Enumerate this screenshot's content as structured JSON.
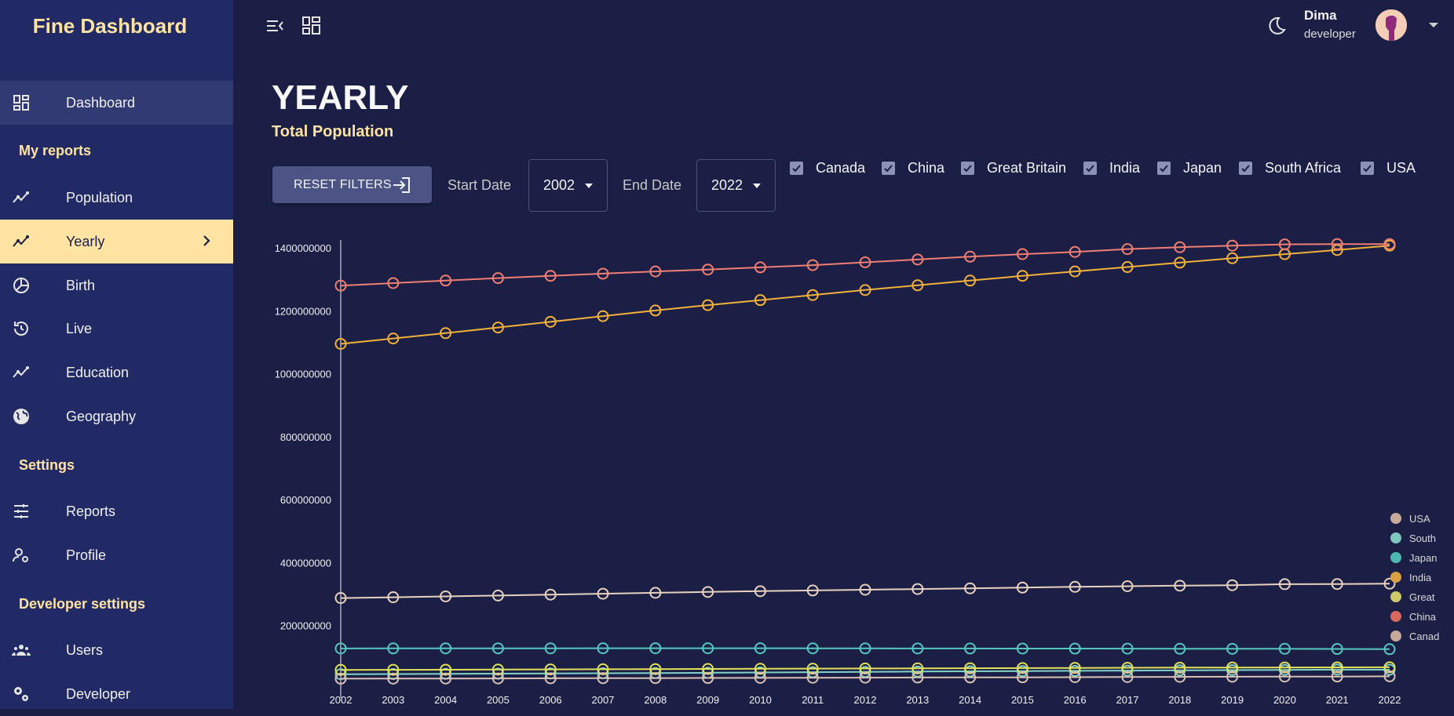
{
  "app": {
    "title": "Fine Dashboard"
  },
  "sidebar": {
    "items": [
      {
        "label": "Dashboard",
        "icon": "dashboard-icon"
      },
      {
        "label": "Population",
        "icon": "trending-icon"
      },
      {
        "label": "Yearly",
        "icon": "trending-icon"
      },
      {
        "label": "Birth",
        "icon": "pie-chart-icon"
      },
      {
        "label": "Live",
        "icon": "history-icon"
      },
      {
        "label": "Education",
        "icon": "trending-icon"
      },
      {
        "label": "Geography",
        "icon": "globe-icon"
      },
      {
        "label": "Reports",
        "icon": "tune-icon"
      },
      {
        "label": "Profile",
        "icon": "person-settings-icon"
      },
      {
        "label": "Users",
        "icon": "group-icon"
      },
      {
        "label": "Developer",
        "icon": "gears-icon"
      }
    ],
    "sections": {
      "reports": "My reports",
      "settings": "Settings",
      "developer": "Developer settings"
    },
    "active": "Yearly"
  },
  "topbar": {
    "user_name": "Dima",
    "user_role": "developer"
  },
  "page": {
    "title": "YEARLY",
    "subtitle": "Total Population"
  },
  "filters": {
    "reset_label": "RESET FILTERS",
    "start_label": "Start Date",
    "start_value": "2002",
    "end_label": "End Date",
    "end_value": "2022",
    "countries": [
      "Canada",
      "China",
      "Great Britain",
      "India",
      "Japan",
      "South Africa",
      "USA"
    ]
  },
  "colors": {
    "background": "#1b1f45",
    "sidebar": "#222a65",
    "accent": "#ffe3a3"
  },
  "chart_data": {
    "type": "line",
    "x": [
      2002,
      2003,
      2004,
      2005,
      2006,
      2007,
      2008,
      2009,
      2010,
      2011,
      2012,
      2013,
      2014,
      2015,
      2016,
      2017,
      2018,
      2019,
      2020,
      2021,
      2022
    ],
    "y_ticks": [
      "200000000",
      "400000000",
      "600000000",
      "800000000",
      "1000000000",
      "1200000000",
      "1400000000"
    ],
    "ylim": [
      0,
      1420000000
    ],
    "legend_position": "right",
    "series": [
      {
        "name": "USA",
        "color": "#e8d2bf",
        "legend_color": "#c9ab9a",
        "values": [
          287600000,
          290100000,
          292800000,
          295500000,
          298400000,
          301200000,
          304100000,
          306800000,
          309300000,
          311600000,
          313900000,
          316100000,
          318400000,
          320700000,
          323100000,
          325100000,
          326800000,
          328300000,
          331500000,
          332000000,
          333300000
        ]
      },
      {
        "name": "South",
        "color": "#7fd3c9",
        "legend_color": "#7fc7c0",
        "values": [
          45500000,
          46100000,
          46700000,
          47300000,
          47900000,
          48600000,
          49300000,
          50000000,
          51000000,
          52000000,
          53000000,
          54000000,
          54700000,
          55400000,
          56200000,
          57000000,
          57800000,
          58600000,
          59300000,
          60000000,
          59900000
        ]
      },
      {
        "name": "Japan",
        "color": "#56c7c0",
        "legend_color": "#4fb9b1",
        "values": [
          127400000,
          127600000,
          127700000,
          127700000,
          127800000,
          128000000,
          128100000,
          128000000,
          128100000,
          127800000,
          127600000,
          127400000,
          127300000,
          127100000,
          127000000,
          126800000,
          126400000,
          126200000,
          126300000,
          125700000,
          125100000
        ]
      },
      {
        "name": "India",
        "color": "#f2b13a",
        "legend_color": "#d9a040",
        "values": [
          1095000000,
          1112000000,
          1129000000,
          1147000000,
          1165000000,
          1183000000,
          1201000000,
          1218000000,
          1234000000,
          1250000000,
          1266000000,
          1281000000,
          1296000000,
          1311000000,
          1325000000,
          1339000000,
          1353000000,
          1367000000,
          1380000000,
          1393000000,
          1407000000
        ]
      },
      {
        "name": "Great",
        "color": "#e3e05a",
        "legend_color": "#cfc96a",
        "values": [
          59400000,
          59600000,
          59900000,
          60400000,
          60800000,
          61300000,
          61800000,
          62300000,
          62800000,
          63300000,
          63700000,
          64100000,
          64600000,
          65100000,
          65600000,
          66000000,
          66400000,
          66800000,
          67100000,
          67300000,
          67500000
        ]
      },
      {
        "name": "China",
        "color": "#f07e72",
        "legend_color": "#d9685f",
        "values": [
          1280000000,
          1288000000,
          1296000000,
          1304000000,
          1311000000,
          1318000000,
          1325000000,
          1331000000,
          1338000000,
          1345000000,
          1354000000,
          1363000000,
          1372000000,
          1380000000,
          1387000000,
          1396000000,
          1402000000,
          1407000000,
          1411000000,
          1412000000,
          1412000000
        ]
      },
      {
        "name": "Canad",
        "color": "#d8c1b4",
        "legend_color": "#c4a89a",
        "values": [
          31400000,
          31600000,
          31900000,
          32200000,
          32600000,
          32900000,
          33200000,
          33600000,
          34000000,
          34300000,
          34700000,
          35100000,
          35400000,
          35700000,
          36100000,
          36500000,
          37100000,
          37600000,
          38000000,
          38200000,
          38900000
        ]
      }
    ]
  }
}
